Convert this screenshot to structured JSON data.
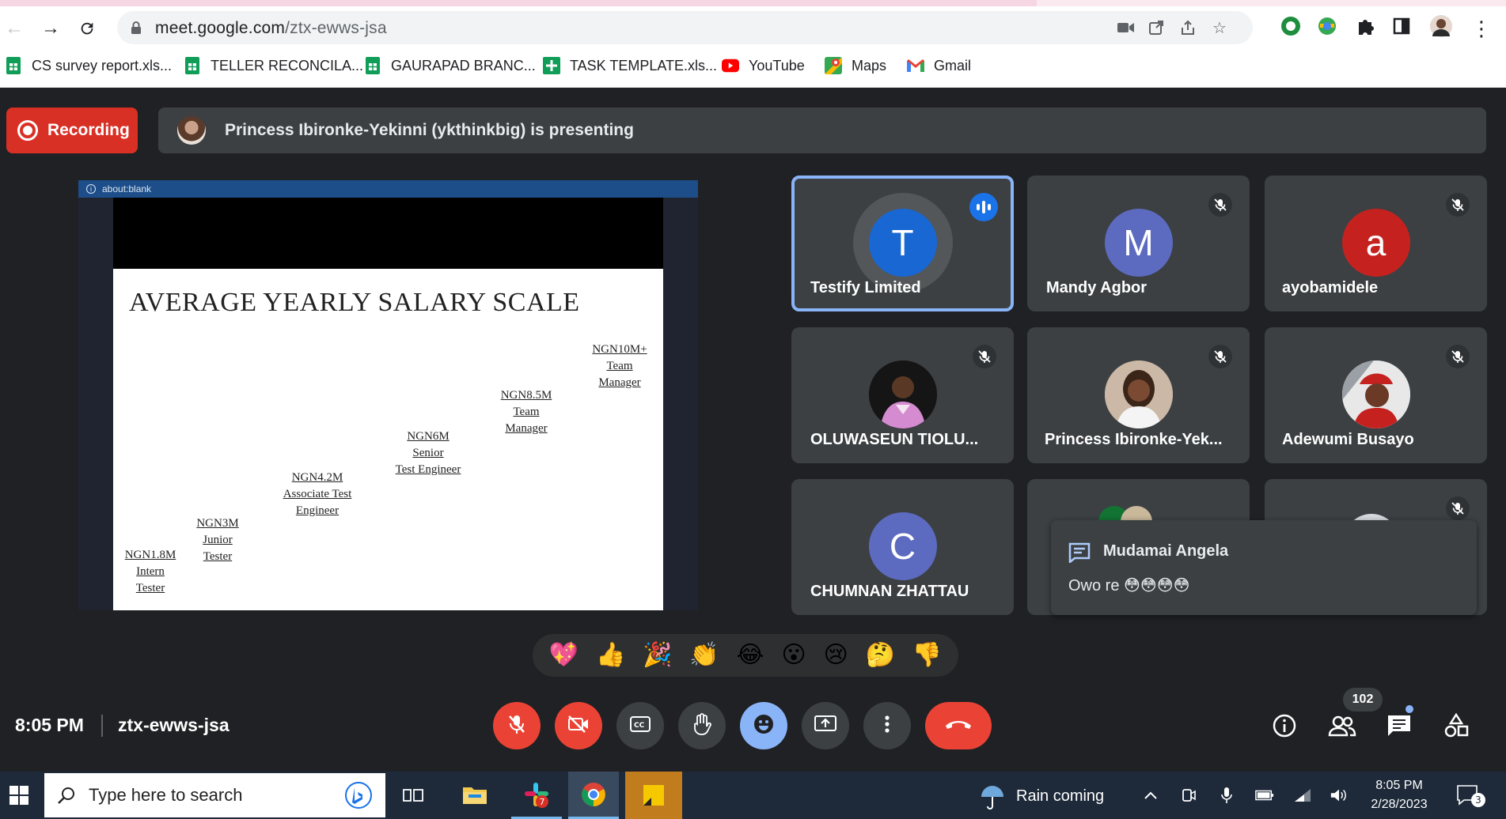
{
  "browser": {
    "url_host": "meet.google.com",
    "url_path": "/ztx-ewws-jsa",
    "bookmarks": [
      {
        "label": "CS survey report.xls...",
        "icon": "sheets-icon"
      },
      {
        "label": "TELLER RECONCILA...",
        "icon": "sheets-icon"
      },
      {
        "label": "GAURAPAD BRANC...",
        "icon": "sheets-icon"
      },
      {
        "label": "TASK TEMPLATE.xls...",
        "icon": "sheets-plus-icon"
      },
      {
        "label": "YouTube",
        "icon": "youtube-icon"
      },
      {
        "label": "Maps",
        "icon": "maps-icon"
      },
      {
        "label": "Gmail",
        "icon": "gmail-icon"
      }
    ]
  },
  "meet": {
    "recording_label": "Recording",
    "presenting_text": "Princess Ibironke-Yekinni (ykthinkbig) is presenting",
    "presentation": {
      "frame_label": "about:blank",
      "title": "AVERAGE YEARLY SALARY SCALE",
      "steps": [
        {
          "lines": [
            "NGN1.8M",
            "Intern",
            "Tester"
          ]
        },
        {
          "lines": [
            "NGN3M",
            "Junior",
            "Tester"
          ]
        },
        {
          "lines": [
            "NGN4.2M",
            "Associate Test",
            "Engineer"
          ]
        },
        {
          "lines": [
            "NGN6M",
            "Senior ",
            "Test Engineer"
          ]
        },
        {
          "lines": [
            "NGN8.5M",
            "Team",
            "Manager"
          ]
        },
        {
          "lines": [
            "NGN10M+",
            "Team",
            "Manager"
          ]
        }
      ]
    },
    "participants": [
      {
        "name": "Testify Limited",
        "initial": "T",
        "color": "#1967d2",
        "speaking": true
      },
      {
        "name": "Mandy Agbor",
        "initial": "M",
        "color": "#5c6bc0",
        "muted": true
      },
      {
        "name": "ayobamidele",
        "initial": "a",
        "color": "#c5221f",
        "muted": true
      },
      {
        "name": "OLUWASEUN TIOLU...",
        "photo": true,
        "muted": true
      },
      {
        "name": "Princess Ibironke-Yek...",
        "photo": true,
        "muted": true
      },
      {
        "name": "Adewumi Busayo",
        "photo": true,
        "muted": true
      },
      {
        "name": "CHUMNAN ZHATTAU",
        "initial": "C",
        "color": "#5c6bc0"
      }
    ],
    "chat_notification": {
      "sender": "Mudamai Angela",
      "message": "Owo re 😳😳😳😳"
    },
    "reactions": [
      "💖",
      "👍",
      "🎉",
      "👏",
      "😂",
      "😮",
      "😢",
      "🤔",
      "👎"
    ],
    "time": "8:05 PM",
    "meeting_code": "ztx-ewws-jsa",
    "participant_count": "102"
  },
  "taskbar": {
    "search_placeholder": "Type here to search",
    "slack_badge": "7",
    "weather": "Rain coming",
    "clock_time": "8:05 PM",
    "clock_date": "2/28/2023",
    "notifications_count": "3"
  }
}
